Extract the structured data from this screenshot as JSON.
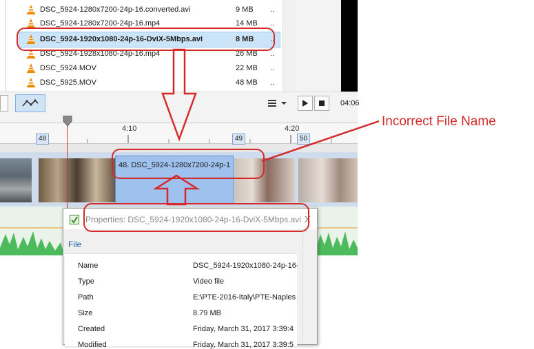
{
  "file_list": {
    "rows": [
      {
        "name": "DSC_5924-1280x7200-24p-16.converted.avi",
        "size": "9 MB",
        "more": "..",
        "highlight": false
      },
      {
        "name": "DSC_5924-1280x7200-24p-16.mp4",
        "size": "14 MB",
        "more": "..",
        "highlight": false
      },
      {
        "name": "DSC_5924-1920x1080-24p-16-DviX-5Mbps.avi",
        "size": "8 MB",
        "more": "..",
        "highlight": true
      },
      {
        "name": "DSC_5924-1928x1080-24p-16.mp4",
        "size": "26 MB",
        "more": "..",
        "highlight": false
      },
      {
        "name": "DSC_5924.MOV",
        "size": "22 MB",
        "more": "..",
        "highlight": false
      },
      {
        "name": "DSC_5925.MOV",
        "size": "48 MB",
        "more": "..",
        "highlight": false
      }
    ]
  },
  "toolbar": {
    "time": "04:06"
  },
  "timeline": {
    "ticks": [
      "4:10",
      "4:20"
    ],
    "markers": [
      "48",
      "49",
      "50"
    ],
    "selected_clip_label": "48. DSC_5924-1280x7200-24p-1"
  },
  "properties_dialog": {
    "title": "Properties: DSC_5924-1920x1080-24p-16-DviX-5Mbps.avi",
    "close": "X",
    "tab": "File",
    "rows": [
      {
        "label": "Name",
        "value": "DSC_5924-1920x1080-24p-16-"
      },
      {
        "label": "Type",
        "value": "Video file"
      },
      {
        "label": "Path",
        "value": "E:\\PTE-2016-Italy\\PTE-Naples"
      },
      {
        "label": "Size",
        "value": "8.79 MB"
      },
      {
        "label": "Created",
        "value": "Friday, March 31, 2017  3:39:4"
      },
      {
        "label": "Modified",
        "value": "Friday, March 31, 2017  3:39:5"
      }
    ]
  },
  "annotation": {
    "text": "Incorrect File Name",
    "color": "#d42a2a"
  }
}
